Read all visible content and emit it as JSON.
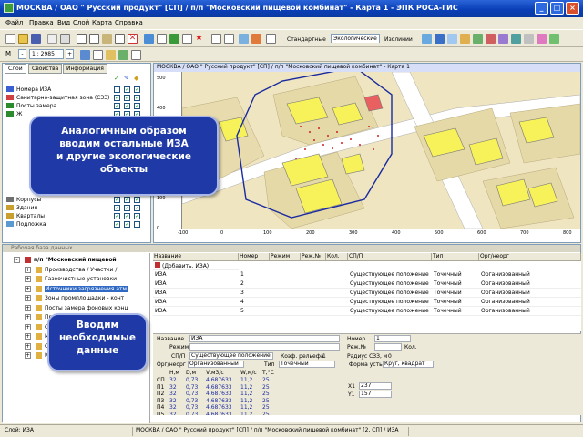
{
  "window": {
    "title": "МОСКВА / ОАО \" Русский продукт\"  [СП] / п/п \"Московский пищевой комбинат\"  - Карта 1  - ЭПК РОСА-ГИС",
    "colors": {
      "titlebar": "#0a3fb8",
      "callout": "#1f3aa6"
    }
  },
  "menu": [
    "Файл",
    "Правка",
    "Вид",
    "Слой",
    "Карта",
    "Справка"
  ],
  "toolbar2": {
    "scale_prefix": "М",
    "scale_value": "1 : 2985"
  },
  "toolbar_tabs": [
    "Стандартные",
    "Экологические",
    "Изолинии"
  ],
  "left_panel": {
    "tabs": [
      "Слои",
      "Свойства",
      "Информация"
    ],
    "layers": [
      {
        "name": "Номера ИЗА",
        "icon": "text-layer-icon",
        "checks": [
          false,
          true,
          true
        ]
      },
      {
        "name": "Санитарно-защитная зона (СЗЗ)",
        "icon": "zone-layer-icon",
        "checks": [
          true,
          true,
          true
        ]
      },
      {
        "name": "Посты замера",
        "icon": "point-layer-icon",
        "checks": [
          true,
          true,
          true
        ]
      },
      {
        "name": "Ж",
        "icon": "point-layer-icon",
        "checks": [
          true,
          true,
          true
        ]
      },
      {
        "name": "Корпусы",
        "icon": "line-layer-icon",
        "checks": [
          true,
          true,
          true
        ]
      },
      {
        "name": "Здания",
        "icon": "polygon-layer-icon",
        "checks": [
          true,
          true,
          true
        ]
      },
      {
        "name": "Кварталы",
        "icon": "polygon-layer-icon",
        "checks": [
          true,
          true,
          true
        ]
      },
      {
        "name": "Подложка",
        "icon": "raster-layer-icon",
        "checks": [
          true,
          true,
          false
        ]
      }
    ]
  },
  "map": {
    "title": "МОСКВА / ОАО \" Русский продукт\" [СП] / п/п \"Московский пищевой комбинат\" - Карта 1",
    "x_ticks": [
      "-100",
      "0",
      "100",
      "200",
      "300",
      "400",
      "500",
      "600",
      "700",
      "800"
    ],
    "y_ticks": [
      "500",
      "400",
      "300",
      "200",
      "100",
      "0"
    ]
  },
  "db_panel": {
    "header": "Рабочая база данных",
    "tree": [
      {
        "label": "п/п \"Московский пищевой",
        "level": 0,
        "icon": "factory-icon",
        "expand": "-",
        "bold": true
      },
      {
        "label": "Производства / Участки /",
        "level": 1,
        "icon": "folder-icon",
        "expand": "+"
      },
      {
        "label": "Газоочистные установки",
        "level": 1,
        "icon": "folder-icon",
        "expand": "+"
      },
      {
        "label": "Источники загрязнения атм",
        "level": 1,
        "icon": "folder-icon",
        "expand": "+",
        "selected": true
      },
      {
        "label": "Зоны промплощадки - конт",
        "level": 1,
        "icon": "folder-icon",
        "expand": "+"
      },
      {
        "label": "Посты замера фоновых конц",
        "level": 1,
        "icon": "folder-icon",
        "expand": "+"
      },
      {
        "label": "Приём / передача, размещ",
        "level": 1,
        "icon": "folder-icon",
        "expand": "+"
      },
      {
        "label": "Отходы - расчет класса опа",
        "level": 1,
        "icon": "folder-icon",
        "expand": "+"
      },
      {
        "label": "Мероприятия по снижению",
        "level": 1,
        "icon": "folder-icon",
        "expand": "+"
      },
      {
        "label": "Организации и договоры",
        "level": 1,
        "icon": "folder-icon",
        "expand": "+"
      },
      {
        "label": "Карта производства",
        "level": 1,
        "icon": "folder-icon",
        "expand": "+"
      }
    ],
    "table": {
      "columns": [
        "Название",
        "Номер",
        "Режим",
        "Реж.№",
        "Кол.",
        "СП/П",
        "Тип",
        "Орг/неорг"
      ],
      "add_row": "(Добавить. ИЗА)",
      "rows": [
        [
          "ИЗА",
          "1",
          "",
          "",
          "",
          "Существующее положение",
          "Точечный",
          "Организованный"
        ],
        [
          "ИЗА",
          "2",
          "",
          "",
          "",
          "Существующее положение",
          "Точечный",
          "Организованный"
        ],
        [
          "ИЗА",
          "3",
          "",
          "",
          "",
          "Существующее положение",
          "Точечный",
          "Организованный"
        ],
        [
          "ИЗА",
          "4",
          "",
          "",
          "",
          "Существующее положение",
          "Точечный",
          "Организованный"
        ],
        [
          "ИЗА",
          "5",
          "",
          "",
          "",
          "Существующее положение",
          "Точечный",
          "Организованный"
        ]
      ]
    },
    "form": {
      "name_label": "Название",
      "name_value": "ИЗА",
      "number_label": "Номер",
      "number_value": "1",
      "mode_label": "Режим",
      "mode_no_label": "Реж.№",
      "count_label": "Кол.",
      "sp_label": "СП/П",
      "sp_value": "Существующее положение",
      "coef_label": "Коэф. рельефа",
      "coef_value": "1",
      "radius_label": "Радиус СЗЗ, м",
      "radius_value": "0",
      "org_label": "Орг/неорг",
      "org_value": "Организованный",
      "type_label": "Тип",
      "type_value": "Точечный",
      "mouth_label": "Форма устья",
      "mouth_value": "Круг, квадрат",
      "param_headers": [
        "Н,м",
        "D,м",
        "V,м3/с",
        "W,м/с",
        "Т,°С"
      ],
      "params": [
        {
          "post": "СП",
          "h": "32",
          "d": "0,73",
          "v": "4,687633",
          "w": "11,2",
          "t": "25"
        },
        {
          "post": "П1",
          "h": "32",
          "d": "0,73",
          "v": "4,687633",
          "w": "11,2",
          "t": "25"
        },
        {
          "post": "П2",
          "h": "32",
          "d": "0,73",
          "v": "4,687633",
          "w": "11,2",
          "t": "25"
        },
        {
          "post": "П3",
          "h": "32",
          "d": "0,73",
          "v": "4,687633",
          "w": "11,2",
          "t": "25"
        },
        {
          "post": "П4",
          "h": "32",
          "d": "0,73",
          "v": "4,687633",
          "w": "11,2",
          "t": "25"
        },
        {
          "post": "П5",
          "h": "32",
          "d": "0,73",
          "v": "4,687633",
          "w": "11,2",
          "t": "25"
        }
      ],
      "x1_label": "X1",
      "x1_value": "237",
      "y1_label": "Y1",
      "y1_value": "157"
    }
  },
  "status": [
    "Слой: ИЗА",
    "МОСКВА / ОАО \" Русский продукт\" [СП] / п/п \"Московский пищевой комбинат\" [2, СП] / ИЗА"
  ],
  "callouts": [
    [
      "Аналогичным образом",
      "вводим остальные ИЗА",
      "и другие экологические",
      "объекты"
    ],
    [
      "Вводим",
      "необходимые",
      "данные"
    ]
  ]
}
